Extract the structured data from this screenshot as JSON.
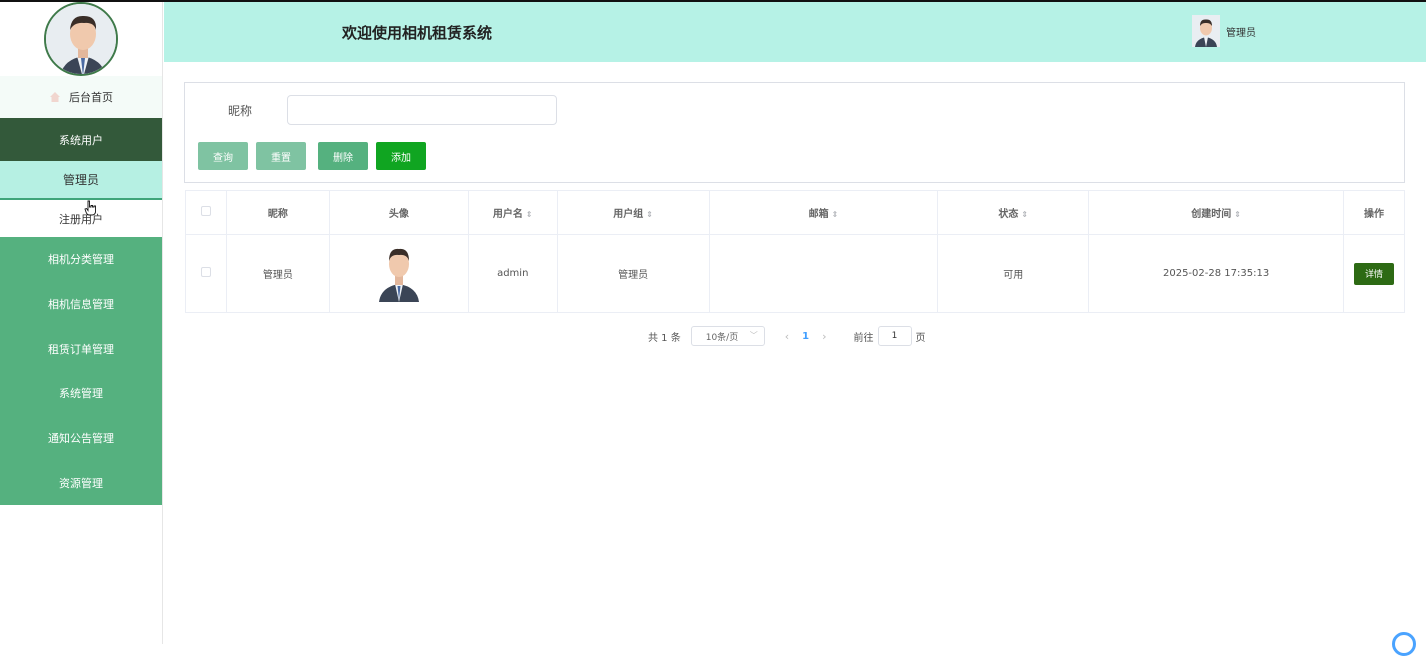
{
  "app": {
    "header_title": "欢迎使用相机租赁系统",
    "header_user": "管理员"
  },
  "sidebar": {
    "home": "后台首页",
    "active_menu": "系统用户",
    "sub_items": [
      "管理员",
      "注册用户"
    ],
    "menu_items": [
      "相机分类管理",
      "相机信息管理",
      "租赁订单管理",
      "系统管理",
      "通知公告管理",
      "资源管理"
    ]
  },
  "search": {
    "label": "昵称",
    "input_value": "",
    "query_btn": "查询",
    "reset_btn": "重置",
    "delete_btn": "删除",
    "add_btn": "添加"
  },
  "table": {
    "headers": [
      "昵称",
      "头像",
      "用户名",
      "用户组",
      "邮箱",
      "状态",
      "创建时间",
      "操作"
    ],
    "rows": [
      {
        "nickname": "管理员",
        "username": "admin",
        "group": "管理员",
        "email": "",
        "status": "可用",
        "created": "2025-02-28 17:35:13",
        "action": "详情"
      }
    ]
  },
  "pagination": {
    "total": "共 1 条",
    "page_size": "10条/页",
    "current": "1",
    "goto_prefix": "前往",
    "goto_value": "1",
    "goto_suffix": "页"
  },
  "colors": {
    "header_bg": "#b6f2e6",
    "sidebar_green": "#55b17f",
    "sidebar_active": "#33593a",
    "add_button": "#10a521",
    "detail_button": "#2d6a14"
  }
}
